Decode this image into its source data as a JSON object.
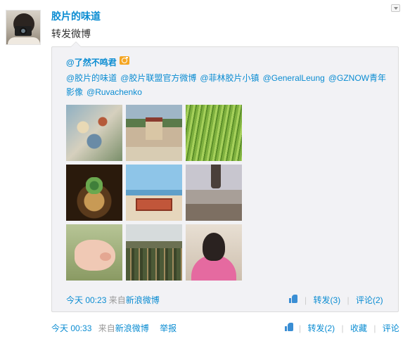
{
  "post": {
    "user_name": "胶片的味道",
    "text": "转发微博",
    "meta": {
      "time": "今天 00:33",
      "from_prefix": "来自",
      "source": "新浪微博",
      "report": "举报"
    },
    "actions": {
      "repost": "转发(2)",
      "favorite": "收藏",
      "comment": "评论",
      "separator": "|"
    }
  },
  "retweet": {
    "author": "@了然不鸣君",
    "mentions": [
      "@胶片的味道",
      "@胶片联盟官方微博",
      "@菲林胶片小镇",
      "@GeneralLeung",
      "@GZNOW青年影像",
      "@Ruvachenko"
    ],
    "photos": [
      "photo-figurines",
      "photo-temple",
      "photo-grass",
      "photo-potted-plant",
      "photo-beach-box",
      "photo-field-figure",
      "photo-pig",
      "photo-cactus-greenhouse",
      "photo-child-chair"
    ],
    "meta": {
      "time": "今天 00:23",
      "from_prefix": "来自",
      "source": "新浪微博"
    },
    "actions": {
      "repost": "转发(3)",
      "comment": "评论(2)",
      "separator": "|"
    }
  },
  "icons": {
    "avatar": "avatar-image",
    "dropdown": "chevron-down-icon",
    "verified": "camera-badge-icon",
    "like": "thumbs-up-icon"
  },
  "colors": {
    "link": "#0a8cd2",
    "meta_gray": "#999999",
    "retweet_bg": "#f2f2f5",
    "badge": "#f5a623"
  }
}
